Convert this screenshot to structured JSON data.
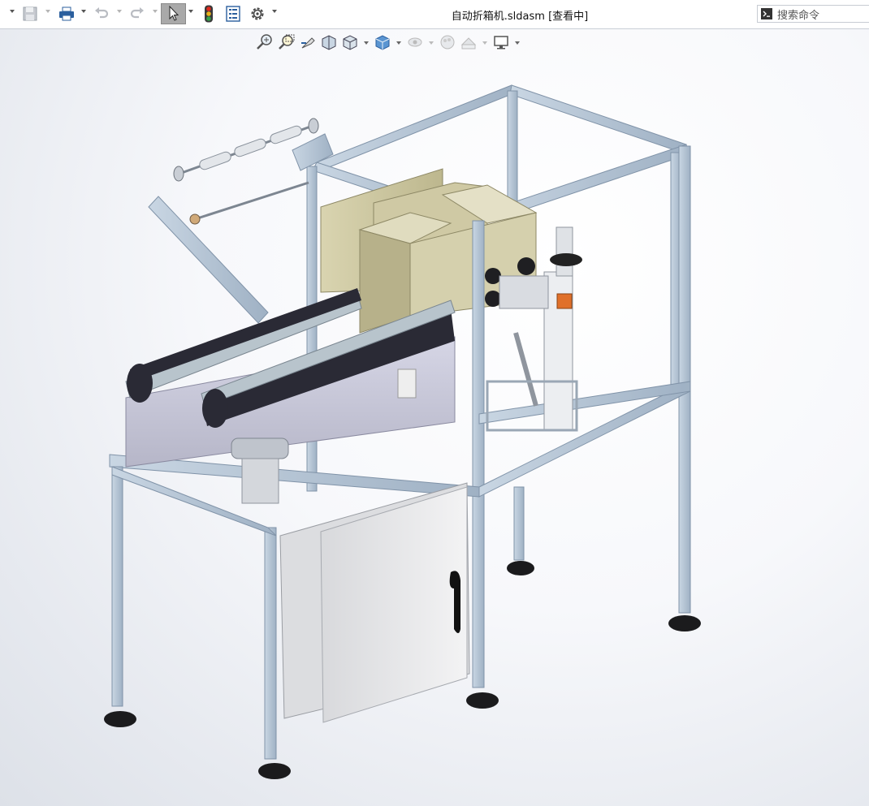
{
  "titlebar": {
    "document_title": "自动折箱机.sldasm [查看中]",
    "search_placeholder": "搜索命令"
  },
  "toolbar": {
    "buttons": [
      "save-icon",
      "print-icon",
      "undo-icon",
      "redo-icon",
      "select-cursor-icon",
      "rebuild-traffic-light-icon",
      "file-properties-icon",
      "options-gear-icon"
    ]
  },
  "view_toolbar": {
    "buttons": [
      "zoom-to-fit-icon",
      "zoom-to-area-icon",
      "previous-view-icon",
      "section-view-icon",
      "view-orientation-icon",
      "display-style-icon",
      "hide-show-items-icon",
      "edit-appearance-icon",
      "apply-scene-icon",
      "view-settings-icon"
    ]
  }
}
